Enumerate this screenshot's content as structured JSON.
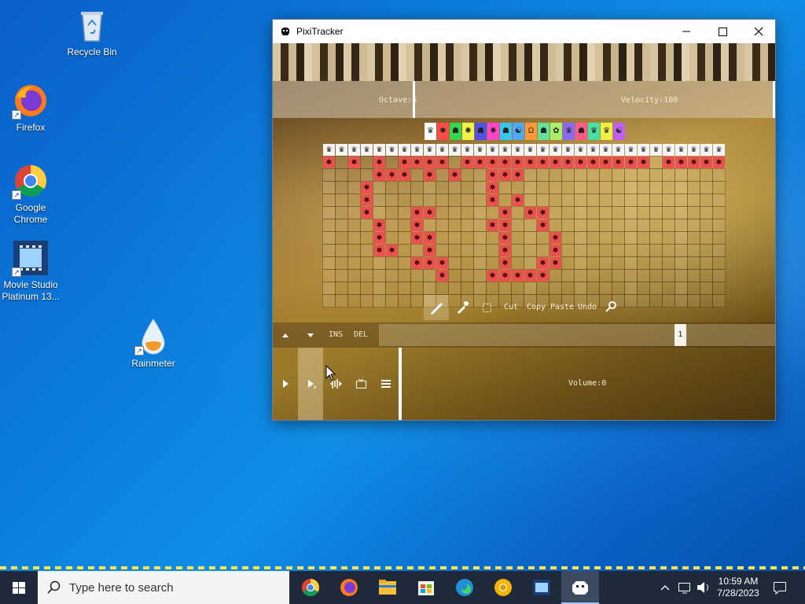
{
  "desktop": {
    "icons": [
      {
        "label": "Recycle Bin",
        "icon": "recycle-bin-icon"
      },
      {
        "label": "Firefox",
        "icon": "firefox-icon"
      },
      {
        "label": "Google Chrome",
        "icon": "chrome-icon"
      },
      {
        "label": "Movie Studio Platinum 13...",
        "icon": "movie-studio-icon"
      },
      {
        "label": "Rainmeter",
        "icon": "rainmeter-icon"
      }
    ]
  },
  "window": {
    "title": "PixiTracker",
    "controls": {
      "minimize": "minimize",
      "maximize": "maximize",
      "close": "close"
    }
  },
  "piano": {
    "octave_label": "Octave:6",
    "velocity_label": "Velocity:100"
  },
  "instruments": [
    {
      "glyph": "♛",
      "color": "#ffffff"
    },
    {
      "glyph": "✱",
      "color": "#ff4a4a"
    },
    {
      "glyph": "☗",
      "color": "#38d650"
    },
    {
      "glyph": "✺",
      "color": "#f2f24a"
    },
    {
      "glyph": "☗",
      "color": "#5250e8"
    },
    {
      "glyph": "✺",
      "color": "#ff46c6"
    },
    {
      "glyph": "☗",
      "color": "#36c6f0"
    },
    {
      "glyph": "☯",
      "color": "#52a8f0"
    },
    {
      "glyph": "Ω",
      "color": "#ff9a3a"
    },
    {
      "glyph": "☗",
      "color": "#63e29a"
    },
    {
      "glyph": "✿",
      "color": "#a8f06a"
    },
    {
      "glyph": "♛",
      "color": "#8a6af0"
    },
    {
      "glyph": "☗",
      "color": "#ff5a8a"
    },
    {
      "glyph": "♛",
      "color": "#46e0a0"
    },
    {
      "glyph": "♛",
      "color": "#f0f040"
    },
    {
      "glyph": "☯",
      "color": "#c060f0"
    }
  ],
  "pattern": {
    "columns": 32,
    "rows": 12,
    "header_glyph": "♛",
    "note_glyph": "✱",
    "notes": [
      [
        0,
        0
      ],
      [
        0,
        2
      ],
      [
        0,
        4
      ],
      [
        0,
        6
      ],
      [
        0,
        7
      ],
      [
        0,
        8
      ],
      [
        0,
        9
      ],
      [
        0,
        11
      ],
      [
        0,
        12
      ],
      [
        0,
        13
      ],
      [
        0,
        14
      ],
      [
        0,
        15
      ],
      [
        0,
        16
      ],
      [
        0,
        17
      ],
      [
        0,
        18
      ],
      [
        0,
        19
      ],
      [
        0,
        20
      ],
      [
        0,
        21
      ],
      [
        0,
        22
      ],
      [
        0,
        23
      ],
      [
        0,
        24
      ],
      [
        0,
        25
      ],
      [
        0,
        27
      ],
      [
        0,
        28
      ],
      [
        0,
        29
      ],
      [
        0,
        30
      ],
      [
        0,
        31
      ],
      [
        1,
        4
      ],
      [
        1,
        5
      ],
      [
        1,
        6
      ],
      [
        1,
        8
      ],
      [
        1,
        10
      ],
      [
        1,
        13
      ],
      [
        1,
        14
      ],
      [
        1,
        15
      ],
      [
        2,
        3
      ],
      [
        2,
        13
      ],
      [
        3,
        3
      ],
      [
        3,
        13
      ],
      [
        3,
        15
      ],
      [
        4,
        3
      ],
      [
        4,
        7
      ],
      [
        4,
        8
      ],
      [
        4,
        14
      ],
      [
        4,
        16
      ],
      [
        4,
        17
      ],
      [
        5,
        4
      ],
      [
        5,
        7
      ],
      [
        5,
        13
      ],
      [
        5,
        14
      ],
      [
        5,
        17
      ],
      [
        6,
        4
      ],
      [
        6,
        7
      ],
      [
        6,
        8
      ],
      [
        6,
        14
      ],
      [
        6,
        18
      ],
      [
        7,
        4
      ],
      [
        7,
        5
      ],
      [
        7,
        8
      ],
      [
        7,
        14
      ],
      [
        7,
        18
      ],
      [
        8,
        7
      ],
      [
        8,
        8
      ],
      [
        8,
        9
      ],
      [
        8,
        14
      ],
      [
        8,
        17
      ],
      [
        8,
        18
      ],
      [
        9,
        9
      ],
      [
        9,
        13
      ],
      [
        9,
        14
      ],
      [
        9,
        15
      ],
      [
        9,
        16
      ],
      [
        9,
        17
      ]
    ]
  },
  "tools": {
    "pencil": "pencil-icon",
    "dropper": "eyedropper-icon",
    "select": "select-icon",
    "cut": "Cut",
    "copy": "Copy",
    "paste": "Paste",
    "undo": "Undo",
    "search": "search-icon"
  },
  "sequencer": {
    "ins": "INS",
    "del": "DEL",
    "position": "1"
  },
  "transport": {
    "volume_label": "Volume:0"
  },
  "taskbar": {
    "search_placeholder": "Type here to search",
    "apps": [
      "chrome",
      "firefox",
      "file-explorer",
      "store",
      "edge",
      "chrome-canary",
      "movie-studio",
      "pixitracker"
    ],
    "time": "10:59 AM",
    "date": "7/28/2023"
  }
}
